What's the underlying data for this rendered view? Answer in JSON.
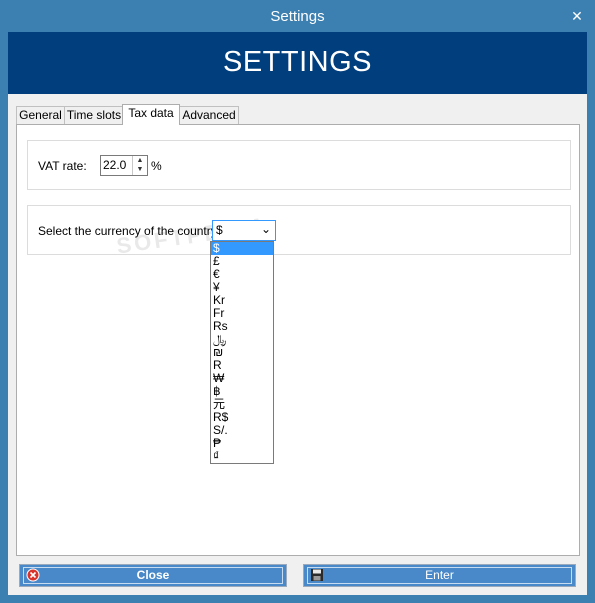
{
  "window": {
    "title": "Settings"
  },
  "banner": {
    "heading": "SETTINGS"
  },
  "tabs": [
    {
      "label": "General"
    },
    {
      "label": "Time slots"
    },
    {
      "label": "Tax data"
    },
    {
      "label": "Advanced"
    }
  ],
  "active_tab": "Tax data",
  "vat": {
    "label": "VAT rate:",
    "value": "22.0",
    "unit": "%"
  },
  "currency": {
    "label": "Select the currency of the country:",
    "selected": "$",
    "options": [
      "$",
      "£",
      "€",
      "¥",
      "Kr",
      "Fr",
      "Rs",
      "﷼",
      "₪",
      "R",
      "₩",
      "฿",
      "元",
      "R$",
      "S/.",
      "₱",
      "₫"
    ]
  },
  "buttons": {
    "close": "Close",
    "enter": "Enter"
  },
  "colors": {
    "titlebar": "#3c7fb1",
    "banner": "#003e7e",
    "selection": "#3399ff",
    "button": "#4a89c9"
  }
}
